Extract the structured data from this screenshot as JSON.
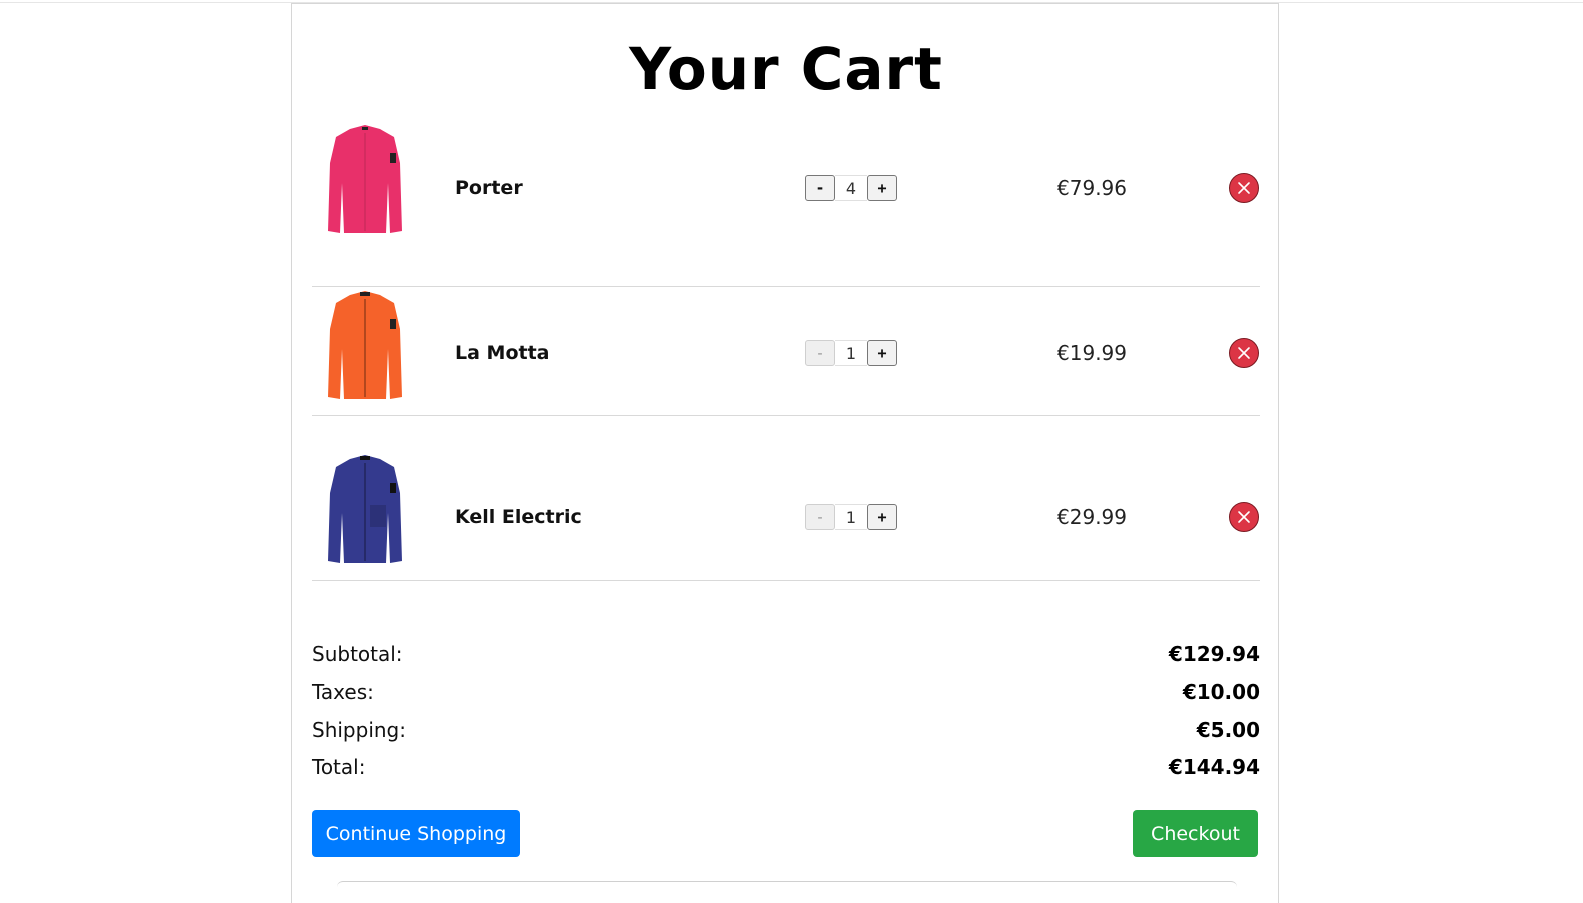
{
  "page": {
    "title": "Your Cart"
  },
  "cart": {
    "items": [
      {
        "name": "Porter",
        "quantity": "4",
        "price": "€79.96",
        "color": "#e8306a",
        "minus_label": "-",
        "plus_label": "+",
        "remove_icon": "close-icon"
      },
      {
        "name": "La Motta",
        "quantity": "1",
        "price": "€19.99",
        "color": "#f5622a",
        "minus_label": "-",
        "plus_label": "+",
        "remove_icon": "close-icon"
      },
      {
        "name": "Kell Electric",
        "quantity": "1",
        "price": "€29.99",
        "color": "#343a8e",
        "minus_label": "-",
        "plus_label": "+",
        "remove_icon": "close-icon"
      }
    ]
  },
  "summary": {
    "subtotal_label": "Subtotal:",
    "subtotal_value": "€129.94",
    "taxes_label": "Taxes:",
    "taxes_value": "€10.00",
    "shipping_label": "Shipping:",
    "shipping_value": "€5.00",
    "total_label": "Total:",
    "total_value": "€144.94"
  },
  "actions": {
    "continue_label": "Continue Shopping",
    "checkout_label": "Checkout"
  },
  "colors": {
    "continue_button": "#007bff",
    "checkout_button": "#28a745",
    "remove_button": "#dc3545"
  }
}
